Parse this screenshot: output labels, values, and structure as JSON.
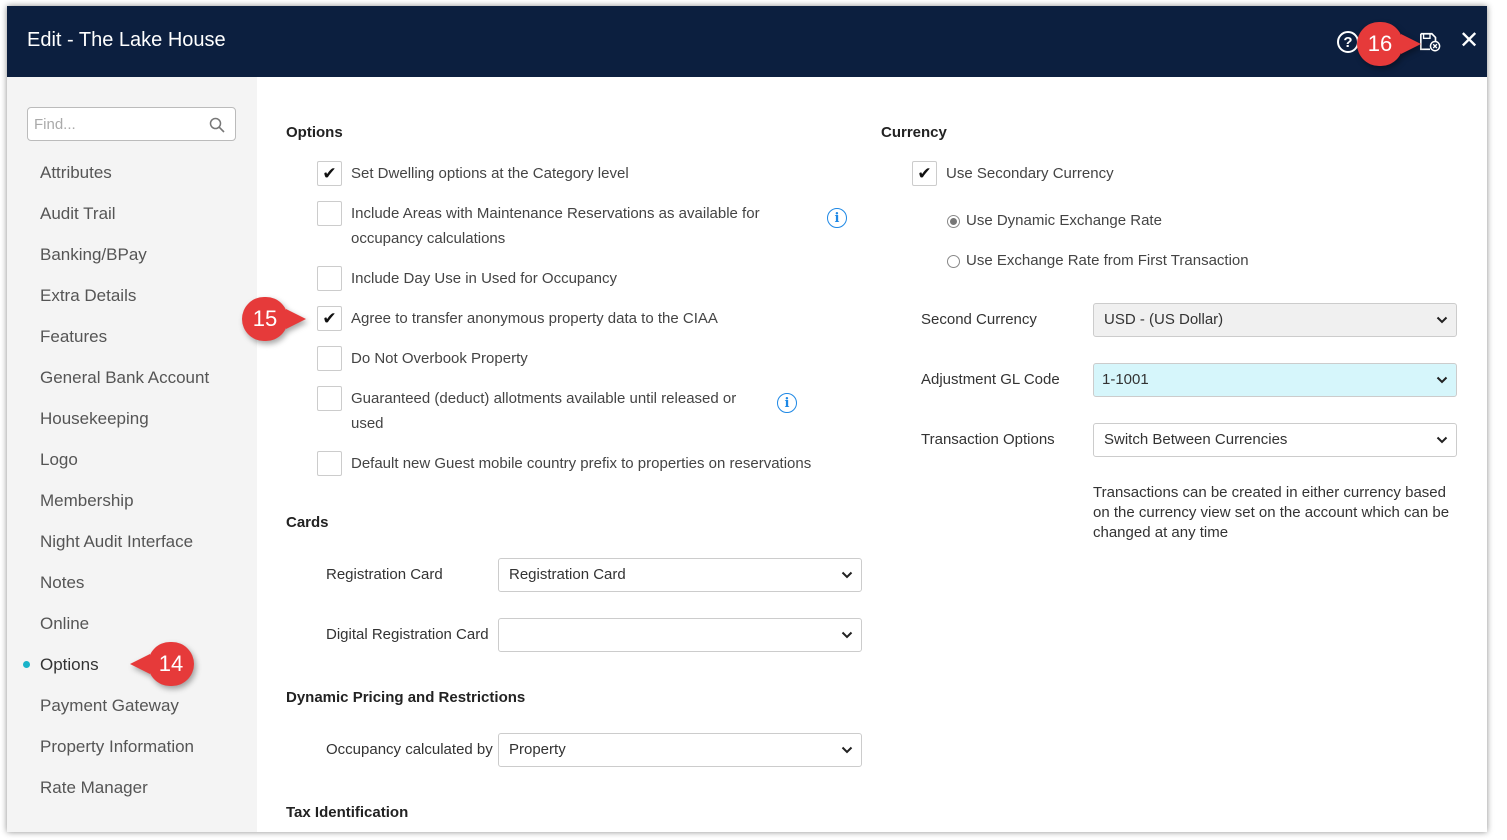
{
  "window": {
    "title": "Edit - The Lake House",
    "help_glyph": "?",
    "close_glyph": "✕"
  },
  "sidebar": {
    "search_placeholder": "Find...",
    "items": [
      {
        "label": "Attributes"
      },
      {
        "label": "Audit Trail"
      },
      {
        "label": "Banking/BPay"
      },
      {
        "label": "Extra Details"
      },
      {
        "label": "Features"
      },
      {
        "label": "General Bank Account"
      },
      {
        "label": "Housekeeping"
      },
      {
        "label": "Logo"
      },
      {
        "label": "Membership"
      },
      {
        "label": "Night Audit Interface"
      },
      {
        "label": "Notes"
      },
      {
        "label": "Online"
      },
      {
        "label": "Options",
        "active": true
      },
      {
        "label": "Payment Gateway"
      },
      {
        "label": "Property Information"
      },
      {
        "label": "Rate Manager"
      }
    ]
  },
  "options": {
    "title": "Options",
    "items": [
      {
        "label": "Set Dwelling options at the Category level",
        "checked": true
      },
      {
        "label_line1": "Include Areas with Maintenance Reservations as available for",
        "label_line2": "occupancy calculations",
        "checked": false
      },
      {
        "label": "Include Day Use in Used for Occupancy",
        "checked": false
      },
      {
        "label": "Agree to transfer anonymous property data to the CIAA",
        "checked": true
      },
      {
        "label": "Do Not Overbook Property",
        "checked": false
      },
      {
        "label_line1": "Guaranteed (deduct) allotments available until released or",
        "label_line2": "used",
        "checked": false
      },
      {
        "label": "Default new Guest mobile country prefix to properties on reservations",
        "checked": false
      }
    ],
    "check_glyph": "✔",
    "info_glyph": "i"
  },
  "cards": {
    "title": "Cards",
    "registration_card_label": "Registration Card",
    "registration_card_value": "Registration Card",
    "digital_registration_card_label": "Digital Registration Card",
    "digital_registration_card_value": ""
  },
  "dynamic_pricing": {
    "title": "Dynamic Pricing and Restrictions",
    "occupancy_label": "Occupancy calculated by",
    "occupancy_value": "Property"
  },
  "tax": {
    "title": "Tax Identification"
  },
  "currency": {
    "title": "Currency",
    "use_secondary_label": "Use Secondary Currency",
    "use_secondary_checked": true,
    "radio_dynamic_label": "Use Dynamic Exchange Rate",
    "radio_first_label": "Use Exchange Rate from First Transaction",
    "selected_rate": "dynamic",
    "second_currency_label": "Second Currency",
    "second_currency_value": "USD - (US Dollar)",
    "adjustment_gl_label": "Adjustment GL Code",
    "adjustment_gl_value": "1-1001",
    "transaction_options_label": "Transaction Options",
    "transaction_options_value": "Switch Between Currencies",
    "note_line1": "Transactions can be created in either currency based",
    "note_line2": "on the currency view set on the account which can be",
    "note_line3": "changed at any time"
  },
  "callouts": {
    "c14": "14",
    "c15": "15",
    "c16": "16"
  },
  "colors": {
    "titlebar": "#0c1f3f",
    "callout": "#e63a3a",
    "active_dot": "#1ab3c9",
    "info_blue": "#1e88e5",
    "gl_field": "#d6f6fb"
  }
}
